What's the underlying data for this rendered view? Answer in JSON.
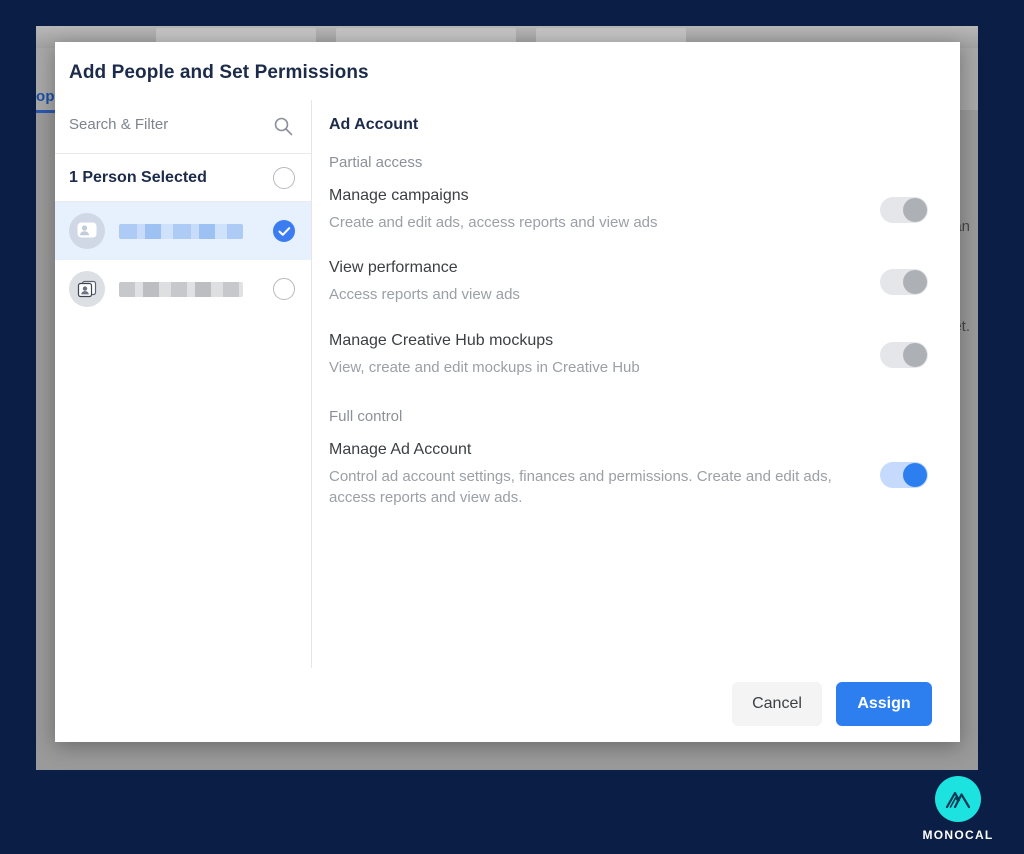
{
  "background": {
    "tab_label_partial": "op",
    "right_text_top": "an",
    "right_text_bottom": "et."
  },
  "modal": {
    "title": "Add People and Set Permissions",
    "left_panel": {
      "search_placeholder": "Search & Filter",
      "search_value": "",
      "search_icon": "search-icon",
      "selected_count_label": "1 Person Selected",
      "select_all_state": "unchecked",
      "people": [
        {
          "name": "",
          "redacted": true,
          "selected": true,
          "avatar_icon": "contact-card-icon"
        },
        {
          "name": "",
          "redacted": true,
          "selected": false,
          "avatar_icon": "contact-card-icon"
        }
      ]
    },
    "right_panel": {
      "heading": "Ad Account",
      "groups": [
        {
          "label": "Partial access",
          "permissions": [
            {
              "title": "Manage campaigns",
              "description": "Create and edit ads, access reports and view ads",
              "enabled": false
            },
            {
              "title": "View performance",
              "description": "Access reports and view ads",
              "enabled": false
            },
            {
              "title": "Manage Creative Hub mockups",
              "description": "View, create and edit mockups in Creative Hub",
              "enabled": false
            }
          ]
        },
        {
          "label": "Full control",
          "permissions": [
            {
              "title": "Manage Ad Account",
              "description": "Control ad account settings, finances and permissions. Create and edit ads, access reports and view ads.",
              "enabled": true
            }
          ]
        }
      ]
    },
    "footer": {
      "cancel_label": "Cancel",
      "assign_label": "Assign"
    }
  },
  "branding": {
    "logo_text": "MONOCAL",
    "logo_icon": "monocal-mountain-icon"
  },
  "colors": {
    "page_border": "#0b1e46",
    "accent_blue": "#2d7ff0",
    "toggle_on_track": "#c5dafc",
    "toggle_off_track": "#e4e6e9",
    "selected_row": "#e7f0fd",
    "logo_teal": "#1ce3e0",
    "title_navy": "#1c2b4a"
  }
}
